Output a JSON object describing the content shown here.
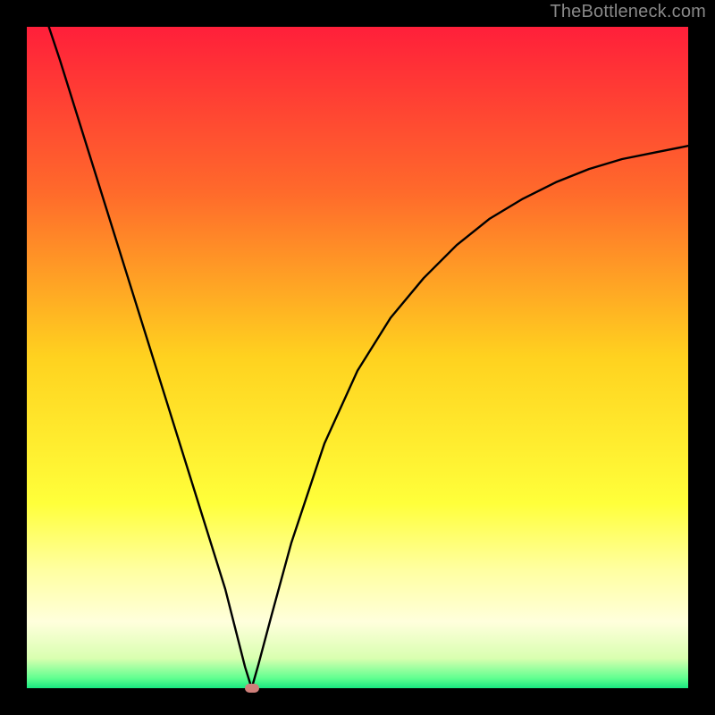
{
  "watermark": "TheBottleneck.com",
  "colors": {
    "frame": "#000000",
    "curve": "#000000",
    "marker": "#cf7f7a",
    "gradient_stops": [
      {
        "offset": 0.0,
        "color": "#ff1f3a"
      },
      {
        "offset": 0.25,
        "color": "#ff6a2b"
      },
      {
        "offset": 0.5,
        "color": "#ffd21f"
      },
      {
        "offset": 0.72,
        "color": "#ffff3a"
      },
      {
        "offset": 0.82,
        "color": "#ffffa0"
      },
      {
        "offset": 0.9,
        "color": "#ffffdc"
      },
      {
        "offset": 0.955,
        "color": "#d9ffb0"
      },
      {
        "offset": 0.985,
        "color": "#60ff90"
      },
      {
        "offset": 1.0,
        "color": "#18e880"
      }
    ]
  },
  "chart_data": {
    "type": "line",
    "title": "",
    "xlabel": "",
    "ylabel": "",
    "xlim": [
      0,
      100
    ],
    "ylim": [
      0,
      100
    ],
    "grid": false,
    "legend": false,
    "series": [
      {
        "name": "bottleneck-curve",
        "x": [
          0,
          5,
          10,
          15,
          20,
          25,
          30,
          33,
          34,
          35,
          37,
          40,
          45,
          50,
          55,
          60,
          65,
          70,
          75,
          80,
          85,
          90,
          95,
          100
        ],
        "y": [
          110,
          95,
          79,
          63,
          47,
          31,
          15,
          3.2,
          0,
          3.5,
          11,
          22,
          37,
          48,
          56,
          62,
          67,
          71,
          74,
          76.5,
          78.5,
          80,
          81,
          82
        ]
      }
    ],
    "marker": {
      "x": 34,
      "y": 0
    },
    "annotations": []
  }
}
